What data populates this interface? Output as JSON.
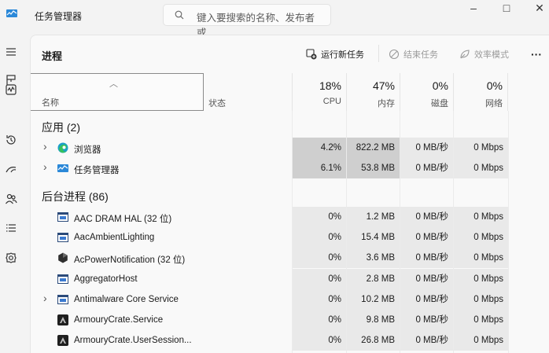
{
  "app": {
    "title": "任务管理器"
  },
  "search": {
    "placeholder": "键入要搜索的名称、发布者或..."
  },
  "window": {
    "minimize": "–",
    "maximize": "□",
    "close": "✕"
  },
  "nav": [
    {
      "name": "nav-menu",
      "icon": "hamburger-icon"
    },
    {
      "name": "nav-processes",
      "icon": "processes-icon"
    },
    {
      "name": "nav-performance",
      "icon": "performance-icon"
    },
    {
      "name": "nav-app-history",
      "icon": "history-icon"
    },
    {
      "name": "nav-startup",
      "icon": "startup-icon"
    },
    {
      "name": "nav-users",
      "icon": "users-icon"
    },
    {
      "name": "nav-details",
      "icon": "details-icon"
    },
    {
      "name": "nav-services",
      "icon": "services-icon"
    }
  ],
  "page": {
    "title": "进程"
  },
  "toolbar": {
    "run_new_task": "运行新任务",
    "end_task": "结束任务",
    "efficiency_mode": "效率模式",
    "more": "···"
  },
  "columns": {
    "name": "名称",
    "status": "状态",
    "cpu": {
      "pct": "18%",
      "label": "CPU"
    },
    "memory": {
      "pct": "47%",
      "label": "内存"
    },
    "disk": {
      "pct": "0%",
      "label": "磁盘"
    },
    "network": {
      "pct": "0%",
      "label": "网络"
    }
  },
  "groups": {
    "apps": "应用 (2)",
    "background": "后台进程 (86)"
  },
  "apps": [
    {
      "name": "浏览器",
      "icon": "edge-icon",
      "expandable": true,
      "cpu": "4.2%",
      "memory": "822.2 MB",
      "disk": "0 MB/秒",
      "network": "0 Mbps"
    },
    {
      "name": "任务管理器",
      "icon": "task-manager-icon",
      "expandable": true,
      "cpu": "6.1%",
      "memory": "53.8 MB",
      "disk": "0 MB/秒",
      "network": "0 Mbps"
    }
  ],
  "background": [
    {
      "name": "AAC DRAM HAL (32 位)",
      "icon": "window-app-icon",
      "expandable": false,
      "cpu": "0%",
      "memory": "1.2 MB",
      "disk": "0 MB/秒",
      "network": "0 Mbps"
    },
    {
      "name": "AacAmbientLighting",
      "icon": "window-app-icon",
      "expandable": false,
      "cpu": "0%",
      "memory": "15.4 MB",
      "disk": "0 MB/秒",
      "network": "0 Mbps"
    },
    {
      "name": "AcPowerNotification (32 位)",
      "icon": "hexagon-icon",
      "expandable": false,
      "cpu": "0%",
      "memory": "3.6 MB",
      "disk": "0 MB/秒",
      "network": "0 Mbps"
    },
    {
      "name": "AggregatorHost",
      "icon": "window-app-icon",
      "expandable": false,
      "cpu": "0%",
      "memory": "2.8 MB",
      "disk": "0 MB/秒",
      "network": "0 Mbps"
    },
    {
      "name": "Antimalware Core Service",
      "icon": "window-app-icon",
      "expandable": true,
      "cpu": "0%",
      "memory": "10.2 MB",
      "disk": "0 MB/秒",
      "network": "0 Mbps"
    },
    {
      "name": "ArmouryCrate.Service",
      "icon": "armoury-crate-icon",
      "expandable": false,
      "cpu": "0%",
      "memory": "9.8 MB",
      "disk": "0 MB/秒",
      "network": "0 Mbps"
    },
    {
      "name": "ArmouryCrate.UserSession...",
      "icon": "armoury-crate-icon",
      "expandable": false,
      "cpu": "0%",
      "memory": "26.8 MB",
      "disk": "0 MB/秒",
      "network": "0 Mbps"
    }
  ],
  "colors": {
    "accent": "#0067c0",
    "heat_high": "#cfcfcf",
    "heat_low": "#e9e9e9",
    "panel_bg": "#f9f9f9",
    "window_bg": "#f3f3f3"
  }
}
